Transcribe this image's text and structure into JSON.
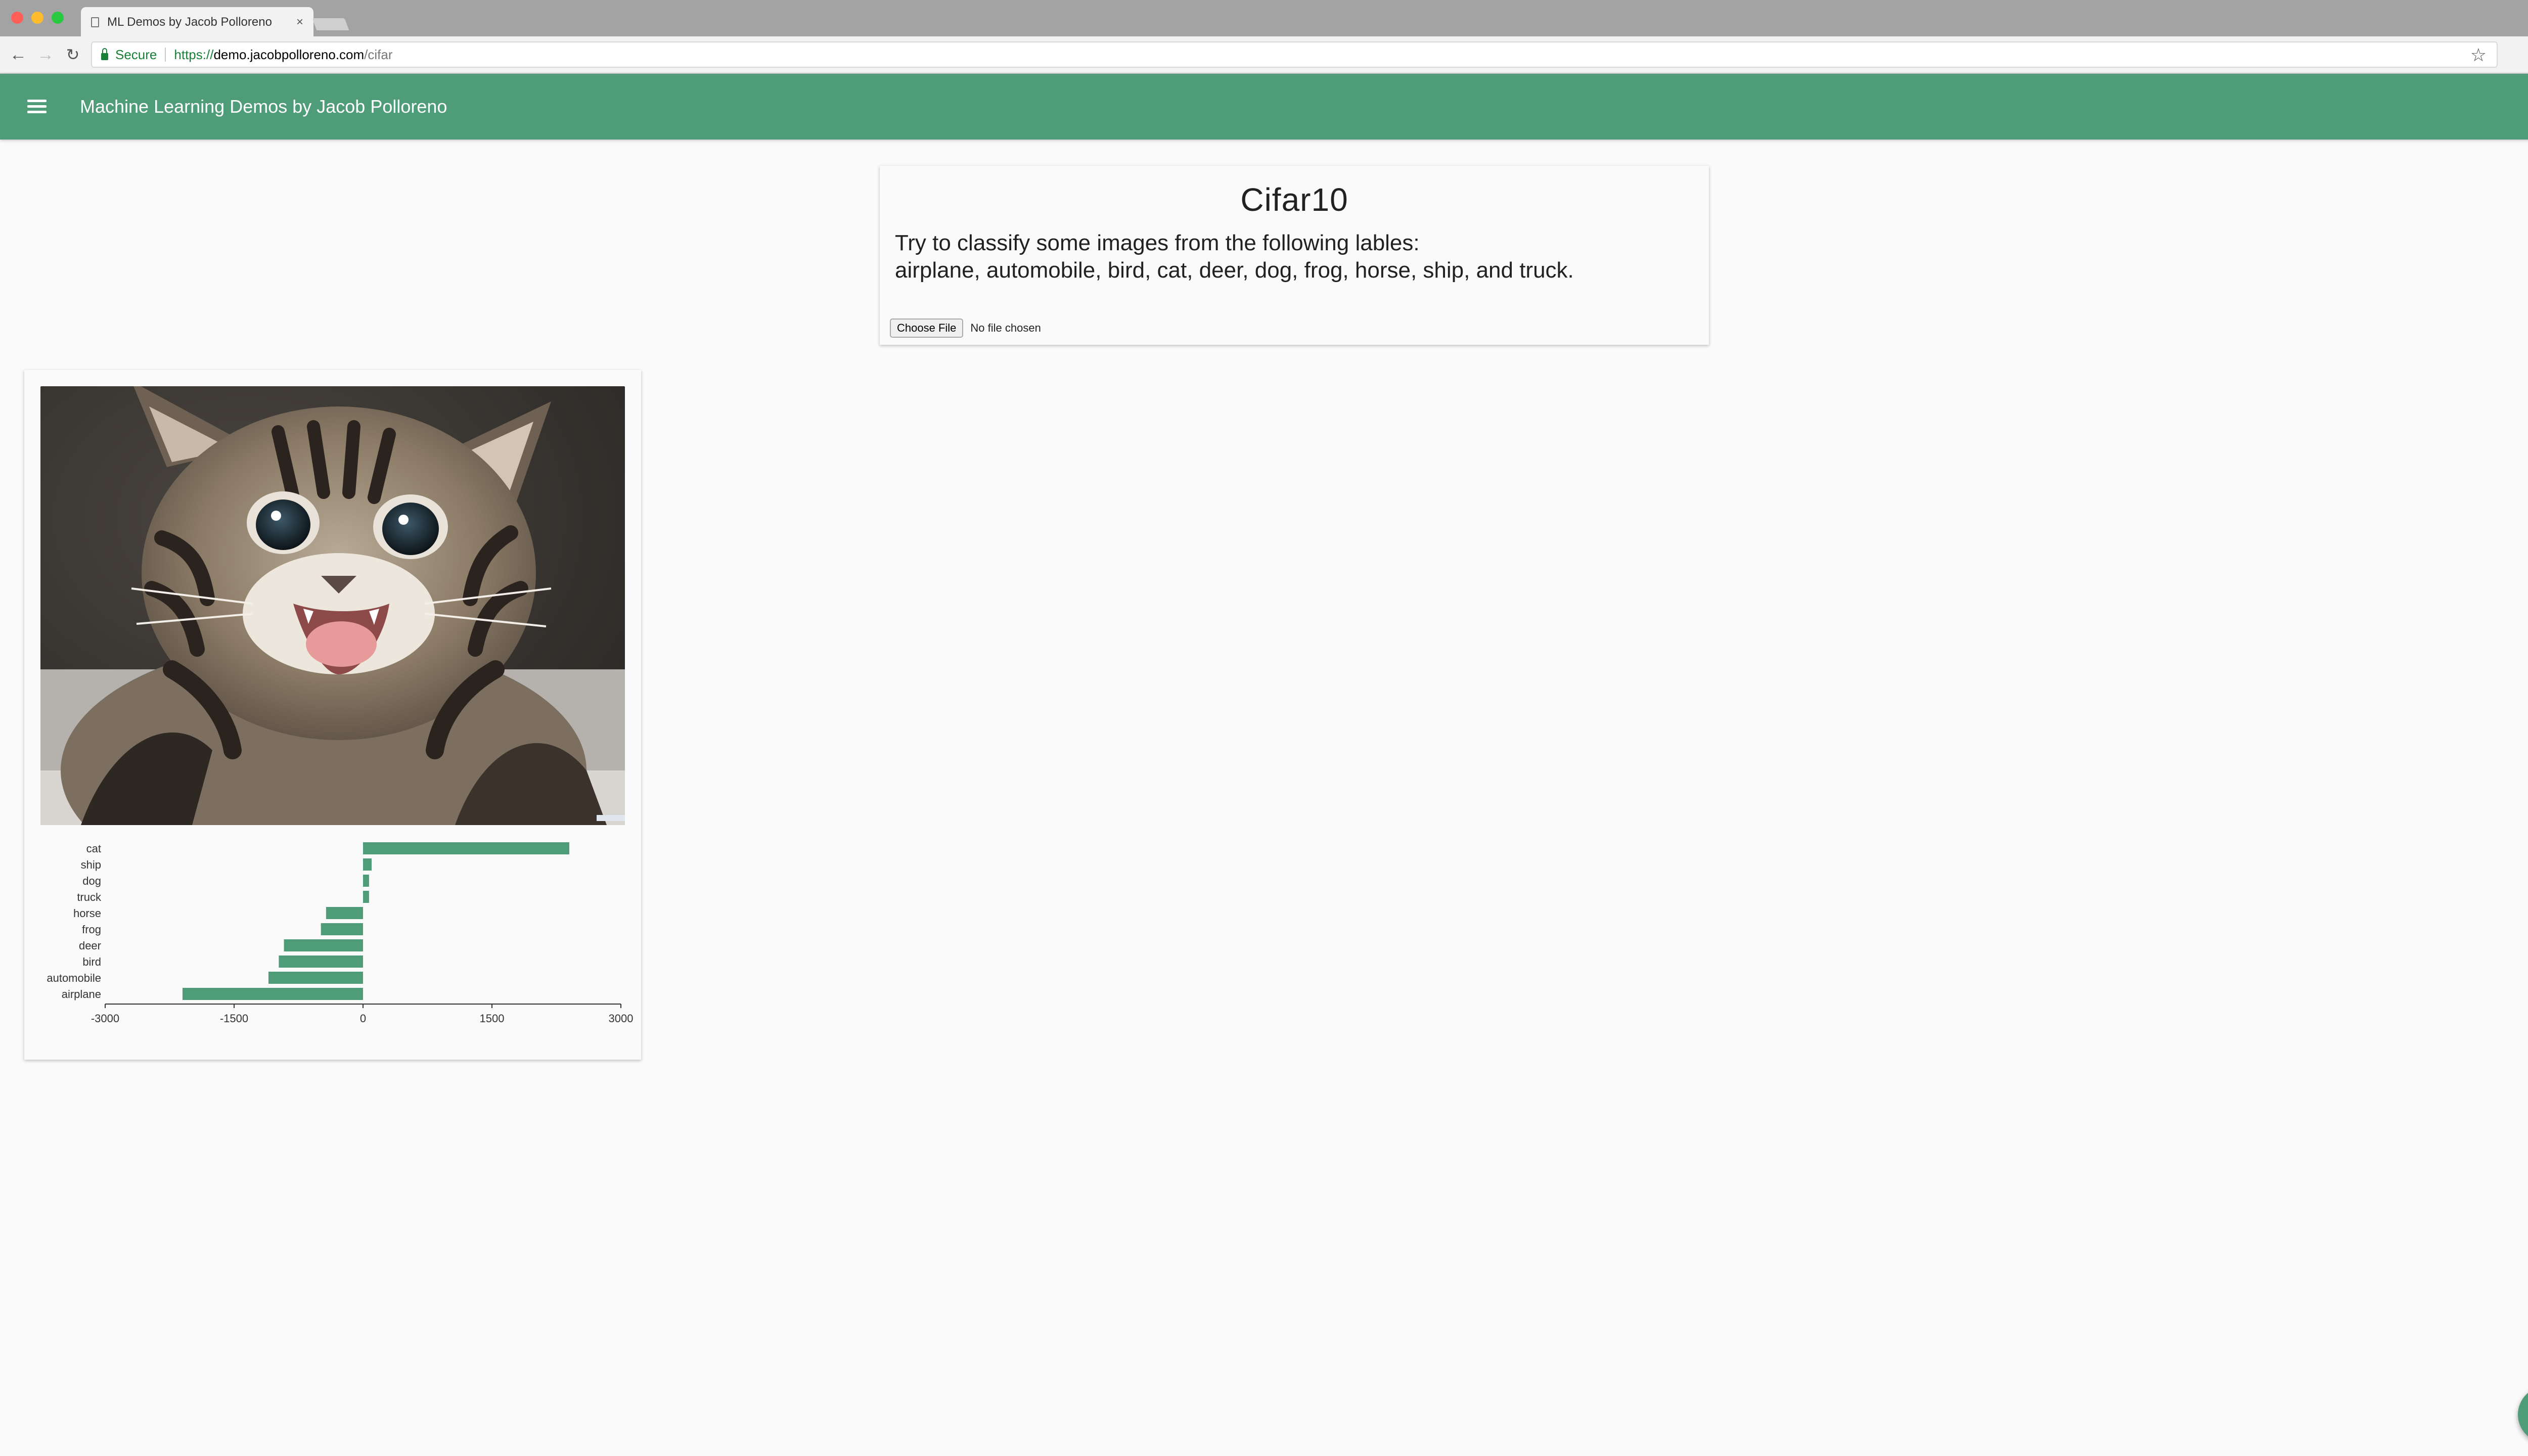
{
  "browser": {
    "tab_title": "ML Demos by Jacob Polloreno",
    "tab_close": "×",
    "secure_label": "Secure",
    "url_protocol": "https://",
    "url_host": "demo.jacobpolloreno.com",
    "url_path": "/cifar"
  },
  "appbar": {
    "title": "Machine Learning Demos by Jacob Polloreno",
    "code_icon_glyph": "<>",
    "color": "#4f9c78"
  },
  "info_card": {
    "heading": "Cifar10",
    "description_line1": "Try to classify some images from the following lables:",
    "description_line2": "airplane, automobile, bird, cat, deer, dog, frog, horse, ship, and truck.",
    "file_button_label": "Choose File",
    "file_status": "No file chosen"
  },
  "result": {
    "image_alt": "kitten"
  },
  "chart_data": {
    "type": "bar",
    "orientation": "horizontal",
    "categories": [
      "cat",
      "ship",
      "dog",
      "truck",
      "horse",
      "frog",
      "deer",
      "bird",
      "automobile",
      "airplane"
    ],
    "values": [
      2400,
      100,
      70,
      70,
      -430,
      -490,
      -920,
      -980,
      -1100,
      -2100
    ],
    "xlim": [
      -3000,
      3000
    ],
    "xticks": [
      -3000,
      -1500,
      0,
      1500,
      3000
    ],
    "bar_color": "#4f9c78",
    "grid": false
  },
  "fab": {
    "icon": "upload-icon"
  }
}
